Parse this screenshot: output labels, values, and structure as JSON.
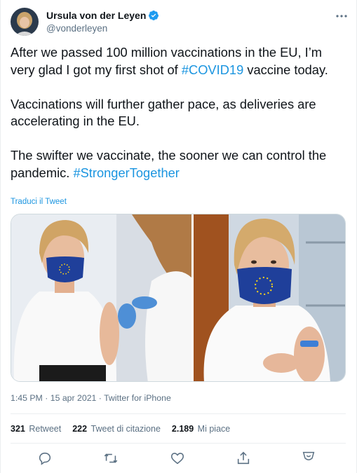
{
  "author": {
    "display_name": "Ursula von der Leyen",
    "handle": "@vonderleyen",
    "verified": true,
    "avatar_icon": "avatar-photo"
  },
  "tweet": {
    "line1_pre": "After we passed 100 million vaccinations in the EU, I’m very glad I got my first shot of ",
    "hashtag1": "#COVID19",
    "line1_post": " vaccine today.\n\nVaccinations will further gather pace, as deliveries are accelerating in the EU.\n\nThe swifter we vaccinate, the sooner we can control the pandemic. ",
    "hashtag2": "#StrongerTogether"
  },
  "translate_label": "Traduci il Tweet",
  "meta": {
    "time": "1:45 PM",
    "separator1": " · ",
    "date": "15 apr 2021",
    "separator2": " · ",
    "source": "Twitter for iPhone"
  },
  "stats": {
    "retweets": "321",
    "retweets_label": "Retweet",
    "quotes": "222",
    "quotes_label": "Tweet di citazione",
    "likes": "2.189",
    "likes_label": "Mi piace"
  },
  "actions": [
    "reply-icon",
    "retweet-icon",
    "like-icon",
    "share-icon",
    "analytics-icon"
  ],
  "colors": {
    "link": "#1b95e0",
    "verified": "#1d9bf0",
    "secondary_text": "#5b7083",
    "eu_blue": "#1f3f9a",
    "eu_star": "#ffd617"
  }
}
